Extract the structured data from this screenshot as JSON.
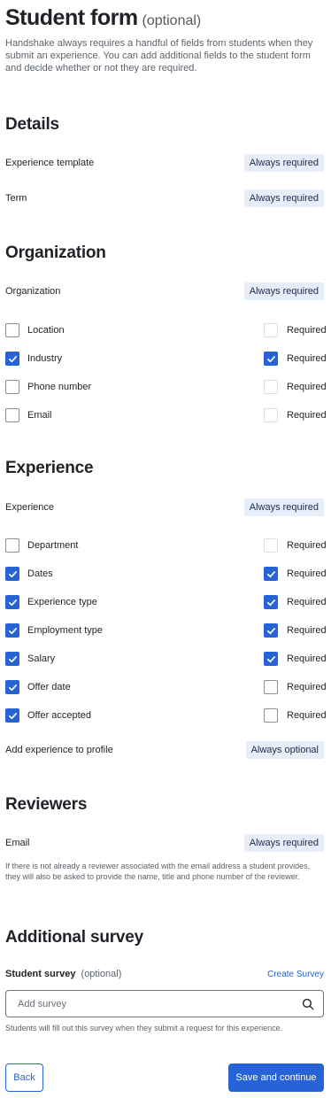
{
  "header": {
    "title": "Student form",
    "title_suffix": "(optional)",
    "intro": "Handshake always requires a handful of fields from students when they submit an experience. You can add additional fields to the student form and decide whether or not they are required."
  },
  "details": {
    "title": "Details",
    "rows": [
      {
        "label": "Experience template",
        "badge": "Always required"
      },
      {
        "label": "Term",
        "badge": "Always required"
      }
    ]
  },
  "organization": {
    "title": "Organization",
    "fixed": {
      "label": "Organization",
      "badge": "Always required"
    },
    "fields": [
      {
        "label": "Location",
        "include": false,
        "required_label": "Required",
        "required": false,
        "required_enabled": false
      },
      {
        "label": "Industry",
        "include": true,
        "required_label": "Required",
        "required": true,
        "required_enabled": true
      },
      {
        "label": "Phone number",
        "include": false,
        "required_label": "Required",
        "required": false,
        "required_enabled": false
      },
      {
        "label": "Email",
        "include": false,
        "required_label": "Required",
        "required": false,
        "required_enabled": false
      }
    ]
  },
  "experience": {
    "title": "Experience",
    "fixed": {
      "label": "Experience",
      "badge": "Always required"
    },
    "fields": [
      {
        "label": "Department",
        "include": false,
        "required_label": "Required",
        "required": false,
        "required_enabled": false
      },
      {
        "label": "Dates",
        "include": true,
        "required_label": "Required",
        "required": true,
        "required_enabled": true
      },
      {
        "label": "Experience type",
        "include": true,
        "required_label": "Required",
        "required": true,
        "required_enabled": true
      },
      {
        "label": "Employment type",
        "include": true,
        "required_label": "Required",
        "required": true,
        "required_enabled": true
      },
      {
        "label": "Salary",
        "include": true,
        "required_label": "Required",
        "required": true,
        "required_enabled": true
      },
      {
        "label": "Offer date",
        "include": true,
        "required_label": "Required",
        "required": false,
        "required_enabled": true
      },
      {
        "label": "Offer accepted",
        "include": true,
        "required_label": "Required",
        "required": false,
        "required_enabled": true
      }
    ],
    "profile": {
      "label": "Add experience to profile",
      "badge": "Always optional"
    }
  },
  "reviewers": {
    "title": "Reviewers",
    "email": {
      "label": "Email",
      "badge": "Always required"
    },
    "note": "If there is not already a reviewer associated with the email address a student provides, they will also be asked to provide the name, title and phone number of the reviewer."
  },
  "survey": {
    "title": "Additional survey",
    "label": "Student survey",
    "optional": "(optional)",
    "create_link": "Create Survey",
    "placeholder": "Add survey",
    "value": "",
    "help": "Students will fill out this survey when they submit a request for this experience."
  },
  "footer": {
    "back_label": "Back",
    "save_label": "Save and continue"
  },
  "colors": {
    "accent": "#2563d6",
    "badge_bg": "#e7eefb"
  },
  "icons": {
    "check": "check-icon",
    "search": "search-icon"
  }
}
